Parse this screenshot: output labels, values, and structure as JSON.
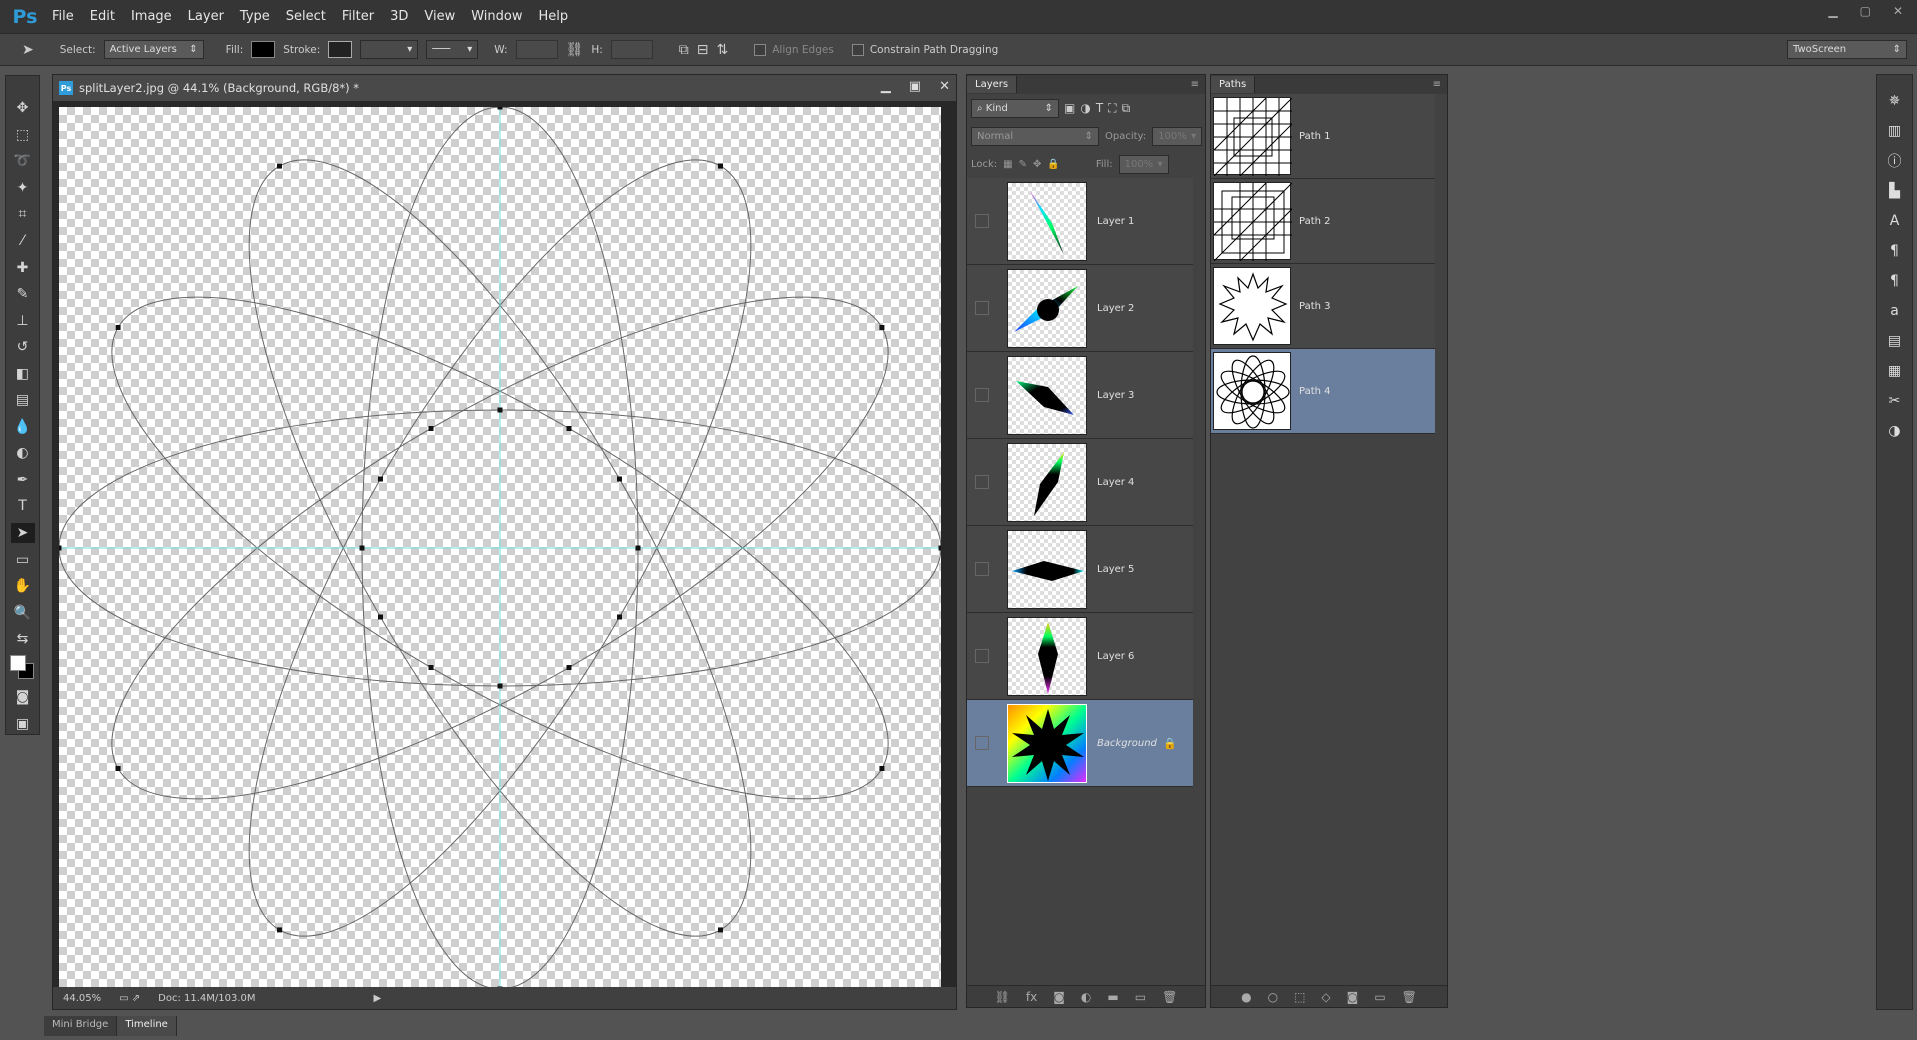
{
  "app": {
    "logo": "Ps"
  },
  "menu": [
    "File",
    "Edit",
    "Image",
    "Layer",
    "Type",
    "Select",
    "Filter",
    "3D",
    "View",
    "Window",
    "Help"
  ],
  "options_bar": {
    "select_label": "Select:",
    "select_value": "Active Layers",
    "fill_label": "Fill:",
    "stroke_label": "Stroke:",
    "w_label": "W:",
    "h_label": "H:",
    "align_edges": "Align Edges",
    "constrain": "Constrain Path Dragging",
    "workspace": "TwoScreen"
  },
  "document": {
    "title": "splitLayer2.jpg @ 44.1% (Background, RGB/8*) *",
    "zoom": "44.05%",
    "doc_info": "Doc: 11.4M/103.0M"
  },
  "layers_panel": {
    "tab": "Layers",
    "filter": "Kind",
    "blend_mode": "Normal",
    "opacity_label": "Opacity:",
    "opacity_value": "100%",
    "lock_label": "Lock:",
    "fill_label": "Fill:",
    "fill_value": "100%",
    "layers": [
      {
        "name": "Layer 1"
      },
      {
        "name": "Layer 2"
      },
      {
        "name": "Layer 3"
      },
      {
        "name": "Layer 4"
      },
      {
        "name": "Layer 5"
      },
      {
        "name": "Layer 6"
      },
      {
        "name": "Background",
        "selected": true,
        "locked": true
      }
    ]
  },
  "paths_panel": {
    "tab": "Paths",
    "paths": [
      {
        "name": "Path 1"
      },
      {
        "name": "Path 2"
      },
      {
        "name": "Path 3"
      },
      {
        "name": "Path 4",
        "selected": true
      }
    ]
  },
  "bottom_tabs": [
    "Mini Bridge",
    "Timeline"
  ],
  "colors": {
    "selection": "#6a7f9e",
    "guide": "#6fe0e0",
    "accent": "#2f9bd9"
  }
}
